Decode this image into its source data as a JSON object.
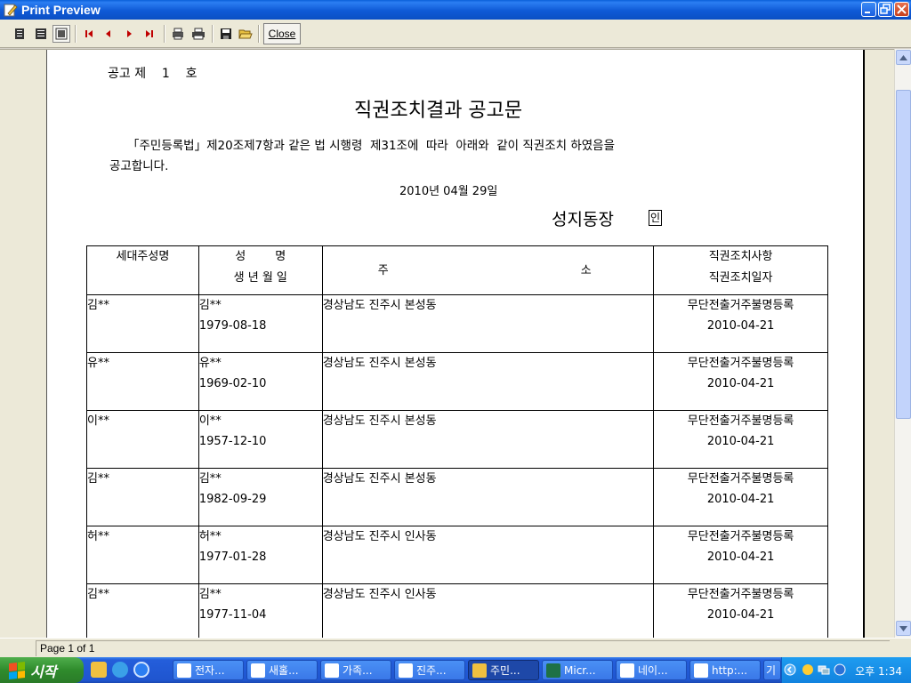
{
  "window": {
    "title": "Print Preview"
  },
  "toolbar": {
    "close_label": "Close"
  },
  "document": {
    "notice_no": "공고 제    1    호",
    "heading": "직권조치결과 공고문",
    "body_line1": "「주민등록법」제20조제7항과 같은 법 시행령  제31조에  따라  아래와  같이 직권조치 하였음을",
    "body_line2": "공고합니다.",
    "date": "2010년 04월 29일",
    "signer": "성지동장",
    "seal": "인",
    "table": {
      "headers": {
        "c1": "세대주성명",
        "c2_line1": "성        명",
        "c2_line2": "생 년 월 일",
        "c3_left": "주",
        "c3_right": "소",
        "c4_line1": "직권조치사항",
        "c4_line2": "직권조치일자"
      },
      "rows": [
        {
          "householder": "김**",
          "name": "김**",
          "birth": "1979-08-18",
          "address": "경상남도 진주시 본성동",
          "action": "무단전출거주불명등록",
          "action_date": "2010-04-21"
        },
        {
          "householder": "유**",
          "name": "유**",
          "birth": "1969-02-10",
          "address": "경상남도 진주시 본성동",
          "action": "무단전출거주불명등록",
          "action_date": "2010-04-21"
        },
        {
          "householder": "이**",
          "name": "이**",
          "birth": "1957-12-10",
          "address": "경상남도 진주시 본성동",
          "action": "무단전출거주불명등록",
          "action_date": "2010-04-21"
        },
        {
          "householder": "김**",
          "name": "김**",
          "birth": "1982-09-29",
          "address": "경상남도 진주시 본성동",
          "action": "무단전출거주불명등록",
          "action_date": "2010-04-21"
        },
        {
          "householder": "허**",
          "name": "허**",
          "birth": "1977-01-28",
          "address": "경상남도 진주시 인사동",
          "action": "무단전출거주불명등록",
          "action_date": "2010-04-21"
        },
        {
          "householder": "김**",
          "name": "김**",
          "birth": "1977-11-04",
          "address": "경상남도 진주시 인사동",
          "action": "무단전출거주불명등록",
          "action_date": "2010-04-21"
        }
      ]
    }
  },
  "status": {
    "page_text": "Page 1 of 1"
  },
  "taskbar": {
    "start_label": "시작",
    "tasks": [
      {
        "label": "전자..."
      },
      {
        "label": "새홀..."
      },
      {
        "label": "가족..."
      },
      {
        "label": "진주..."
      },
      {
        "label": "주민..."
      },
      {
        "label": "Micr..."
      },
      {
        "label": "네이..."
      },
      {
        "label": "http:..."
      },
      {
        "label": "기"
      }
    ],
    "clock": "오후 1:34"
  },
  "colors": {
    "titlebar": "#0b4fc4",
    "taskbar": "#245edb",
    "start": "#2f8b2c"
  }
}
